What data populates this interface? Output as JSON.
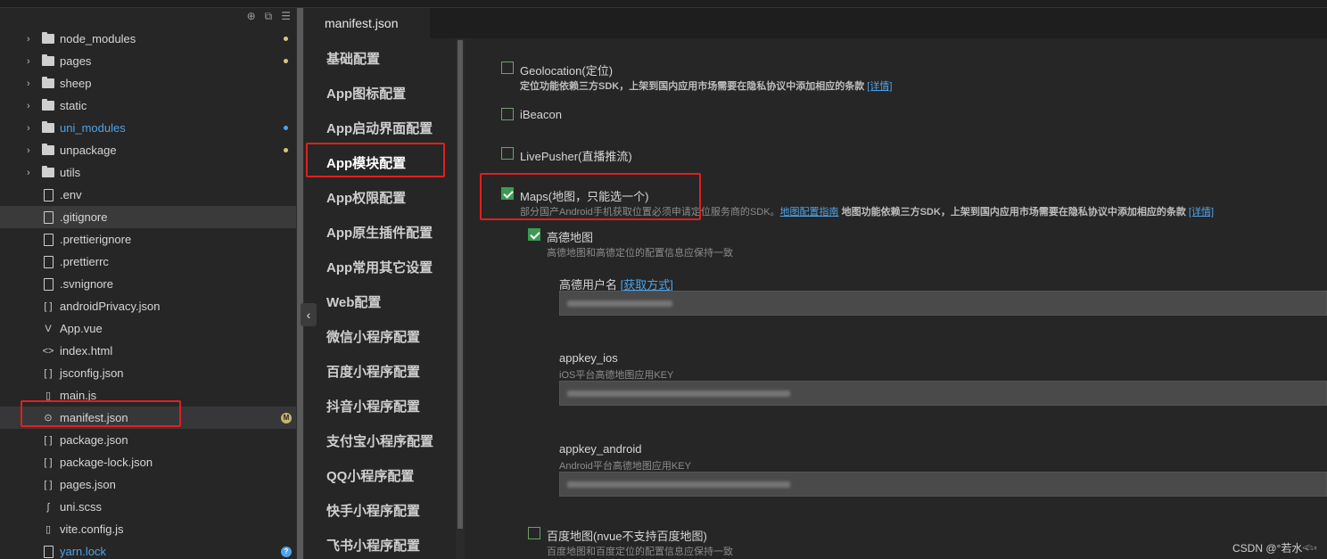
{
  "explorer": {
    "tools": [
      "⊕",
      "⧉",
      "☰"
    ],
    "items": [
      {
        "label": "node_modules",
        "type": "folder",
        "dot": "yellow"
      },
      {
        "label": "pages",
        "type": "folder",
        "dot": "yellow"
      },
      {
        "label": "sheep",
        "type": "folder"
      },
      {
        "label": "static",
        "type": "folder"
      },
      {
        "label": "uni_modules",
        "type": "folder",
        "dot": "blue",
        "blue": true
      },
      {
        "label": "unpackage",
        "type": "folder",
        "dot": "yellow"
      },
      {
        "label": "utils",
        "type": "folder"
      },
      {
        "label": ".env",
        "type": "file"
      },
      {
        "label": ".gitignore",
        "type": "file",
        "highlight": true
      },
      {
        "label": ".prettierignore",
        "type": "file"
      },
      {
        "label": ".prettierrc",
        "type": "file"
      },
      {
        "label": ".svnignore",
        "type": "file"
      },
      {
        "label": "androidPrivacy.json",
        "type": "json"
      },
      {
        "label": "App.vue",
        "type": "vue"
      },
      {
        "label": "index.html",
        "type": "html"
      },
      {
        "label": "jsconfig.json",
        "type": "json"
      },
      {
        "label": "main.js",
        "type": "js"
      },
      {
        "label": "manifest.json",
        "type": "manifest",
        "selected": true,
        "badge": "M"
      },
      {
        "label": "package.json",
        "type": "json"
      },
      {
        "label": "package-lock.json",
        "type": "json"
      },
      {
        "label": "pages.json",
        "type": "json"
      },
      {
        "label": "uni.scss",
        "type": "scss"
      },
      {
        "label": "vite.config.js",
        "type": "js"
      },
      {
        "label": "yarn.lock",
        "type": "file",
        "blue": true,
        "badge": "?"
      }
    ]
  },
  "tab": {
    "title": "manifest.json"
  },
  "nav": {
    "items": [
      "基础配置",
      "App图标配置",
      "App启动界面配置",
      "App模块配置",
      "App权限配置",
      "App原生插件配置",
      "App常用其它设置",
      "Web配置",
      "微信小程序配置",
      "百度小程序配置",
      "抖音小程序配置",
      "支付宝小程序配置",
      "QQ小程序配置",
      "快手小程序配置",
      "飞书小程序配置"
    ],
    "active_index": 3
  },
  "modules": {
    "geolocation": {
      "label": "Geolocation(定位)",
      "desc": "定位功能依赖三方SDK，上架到国内应用市场需要在隐私协议中添加相应的条款",
      "link": "[详情]"
    },
    "ibeacon": {
      "label": "iBeacon"
    },
    "livepusher": {
      "label": "LivePusher(直播推流)"
    },
    "maps": {
      "label": "Maps(地图，只能选一个)",
      "desc_a": "部分国产Android手机获取位置必须申请定位服务商的SDK。",
      "link_a": "地图配置指南",
      "desc_b": "地图功能依赖三方SDK，上架到国内应用市场需要在隐私协议中添加相应的条款",
      "link_b": "[详情]"
    },
    "amap": {
      "label": "高德地图",
      "desc": "高德地图和高德定位的配置信息应保持一致",
      "user_label": "高德用户名",
      "user_link": "[获取方式]",
      "ios_label": "appkey_ios",
      "ios_desc": "iOS平台高德地图应用KEY",
      "android_label": "appkey_android",
      "android_desc": "Android平台高德地图应用KEY"
    },
    "baidu": {
      "label": "百度地图(nvue不支持百度地图)",
      "desc": "百度地图和百度定位的配置信息应保持一致"
    }
  },
  "watermark": "CSDN @°若水𓆟"
}
